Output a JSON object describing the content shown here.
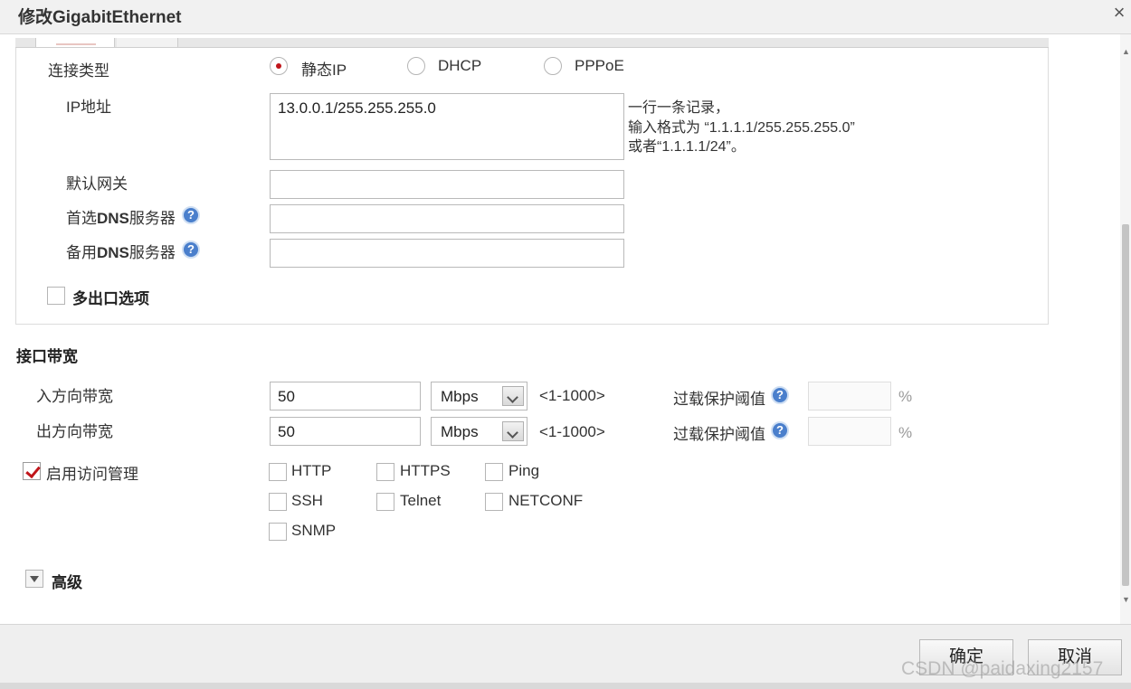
{
  "window": {
    "title": "修改GigabitEthernet",
    "close_icon": "×"
  },
  "connection": {
    "label": "连接类型",
    "options": [
      {
        "label": "静态IP",
        "selected": true
      },
      {
        "label": "DHCP",
        "selected": false
      },
      {
        "label": "PPPoE",
        "selected": false
      }
    ]
  },
  "ip": {
    "label": "IP地址",
    "value": "13.0.0.1/255.255.255.0",
    "hint": [
      "一行一条记录，",
      "输入格式为 “1.1.1.1/255.255.255.0”",
      "或者“1.1.1.1/24”。"
    ]
  },
  "gateway": {
    "label": "默认网关",
    "value": ""
  },
  "dns_primary": {
    "label_prefix": "首选",
    "label_bold": "DNS",
    "label_suffix": "服务器",
    "value": ""
  },
  "dns_backup": {
    "label_prefix": "备用",
    "label_bold": "DNS",
    "label_suffix": "服务器",
    "value": ""
  },
  "help_icon": "?",
  "multi_exit": {
    "label": "多出口选项",
    "checked": false
  },
  "bandwidth": {
    "section_title": "接口带宽",
    "inbound": {
      "label": "入方向带宽",
      "value": "50",
      "unit": "Mbps",
      "range": "<1-1000>",
      "overload_label": "过载保护阈值",
      "overload_value": "",
      "percent": "%"
    },
    "outbound": {
      "label": "出方向带宽",
      "value": "50",
      "unit": "Mbps",
      "range": "<1-1000>",
      "overload_label": "过载保护阈值",
      "overload_value": "",
      "percent": "%"
    }
  },
  "access": {
    "label": "启用访问管理",
    "checked": true,
    "services": [
      {
        "label": "HTTP",
        "checked": false
      },
      {
        "label": "HTTPS",
        "checked": false
      },
      {
        "label": "Ping",
        "checked": false
      },
      {
        "label": "SSH",
        "checked": false
      },
      {
        "label": "Telnet",
        "checked": false
      },
      {
        "label": "NETCONF",
        "checked": false
      },
      {
        "label": "SNMP",
        "checked": false
      }
    ]
  },
  "advanced": {
    "label": "高级"
  },
  "footer": {
    "ok": "确定",
    "cancel": "取消"
  },
  "watermark": "CSDN @paidaxing2157"
}
